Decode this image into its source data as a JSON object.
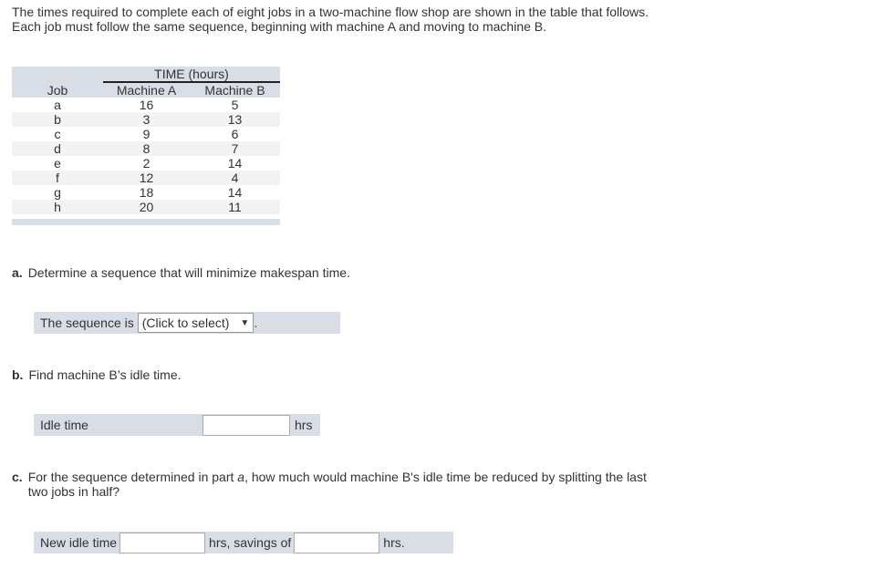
{
  "intro": "The times required to complete each of eight jobs in a two-machine flow shop are shown in the table that follows. Each job must follow the same sequence, beginning with machine A and moving to machine B.",
  "table": {
    "group_header": "TIME (hours)",
    "headers": [
      "Job",
      "Machine A",
      "Machine B"
    ],
    "rows": [
      {
        "job": "a",
        "a": "16",
        "b": "5"
      },
      {
        "job": "b",
        "a": "3",
        "b": "13"
      },
      {
        "job": "c",
        "a": "9",
        "b": "6"
      },
      {
        "job": "d",
        "a": "8",
        "b": "7"
      },
      {
        "job": "e",
        "a": "2",
        "b": "14"
      },
      {
        "job": "f",
        "a": "12",
        "b": "4"
      },
      {
        "job": "g",
        "a": "18",
        "b": "14"
      },
      {
        "job": "h",
        "a": "20",
        "b": "11"
      }
    ]
  },
  "part_a": {
    "letter": "a.",
    "question": "Determine a sequence that will minimize makespan time.",
    "label": "The sequence is",
    "select_value": "(Click to select)",
    "arrow": "▼",
    "suffix": "."
  },
  "part_b": {
    "letter": "b.",
    "question": "Find machine B’s idle time.",
    "label": "Idle time",
    "value": "",
    "unit": "hrs"
  },
  "part_c": {
    "letter": "c.",
    "question_pre": "For the sequence determined in part ",
    "question_em": "a",
    "question_post": ", how much would machine B's idle time be reduced by splitting the last two jobs in half?",
    "label": "New idle time",
    "value1": "",
    "mid": "hrs, savings of",
    "value2": "",
    "unit": "hrs."
  }
}
